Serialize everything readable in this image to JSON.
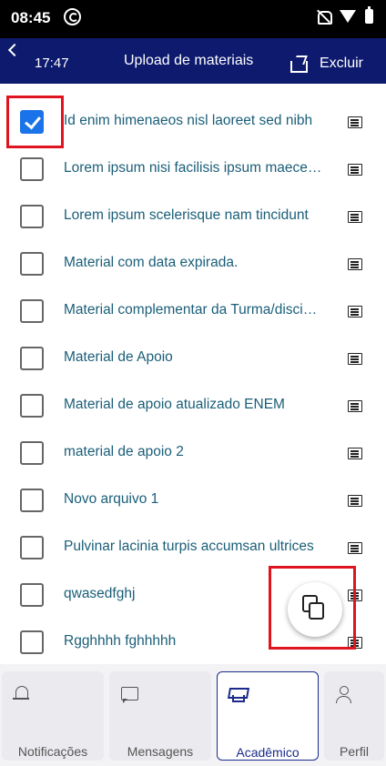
{
  "status_bar": {
    "time": "08:45",
    "icons": [
      "sync-icon",
      "mute-icon",
      "wifi-icon",
      "battery-icon"
    ]
  },
  "app_bar": {
    "back_icon": "chevron-left-icon",
    "clock": "17:47",
    "title": "Upload de materiais",
    "share_icon": "share-icon",
    "delete_label": "Excluir"
  },
  "colors": {
    "app_bar": "#0d1a6e",
    "item_text": "#1a5e78",
    "checkbox_checked": "#1a73e8",
    "highlight_box": "#e0141e",
    "active_tab": "#1a2a8a"
  },
  "materials": [
    {
      "label": "Id enim himenaeos nisl laoreet sed nibh",
      "checked": true
    },
    {
      "label": "Lorem ipsum nisi facilisis ipsum maecenas",
      "checked": false
    },
    {
      "label": "Lorem ipsum scelerisque nam tincidunt",
      "checked": false
    },
    {
      "label": "Material com data expirada.",
      "checked": false
    },
    {
      "label": "Material complementar da Turma/disciplina",
      "checked": false
    },
    {
      "label": "Material de Apoio",
      "checked": false
    },
    {
      "label": "Material de apoio atualizado ENEM",
      "checked": false
    },
    {
      "label": "material de apoio 2",
      "checked": false
    },
    {
      "label": "Novo arquivo 1",
      "checked": false
    },
    {
      "label": "Pulvinar lacinia turpis accumsan ultrices",
      "checked": false
    },
    {
      "label": "qwasedfghj",
      "checked": false
    },
    {
      "label": "Rgghhhh fghhhhh",
      "checked": false
    }
  ],
  "fab": {
    "icon": "copy-icon"
  },
  "bottom_nav": [
    {
      "label": "Notificações",
      "icon": "bell-icon",
      "active": false
    },
    {
      "label": "Mensagens",
      "icon": "message-icon",
      "active": false
    },
    {
      "label": "Acadêmico",
      "icon": "graduation-cap-icon",
      "active": true
    },
    {
      "label": "Perfil",
      "icon": "person-icon",
      "active": false
    }
  ]
}
